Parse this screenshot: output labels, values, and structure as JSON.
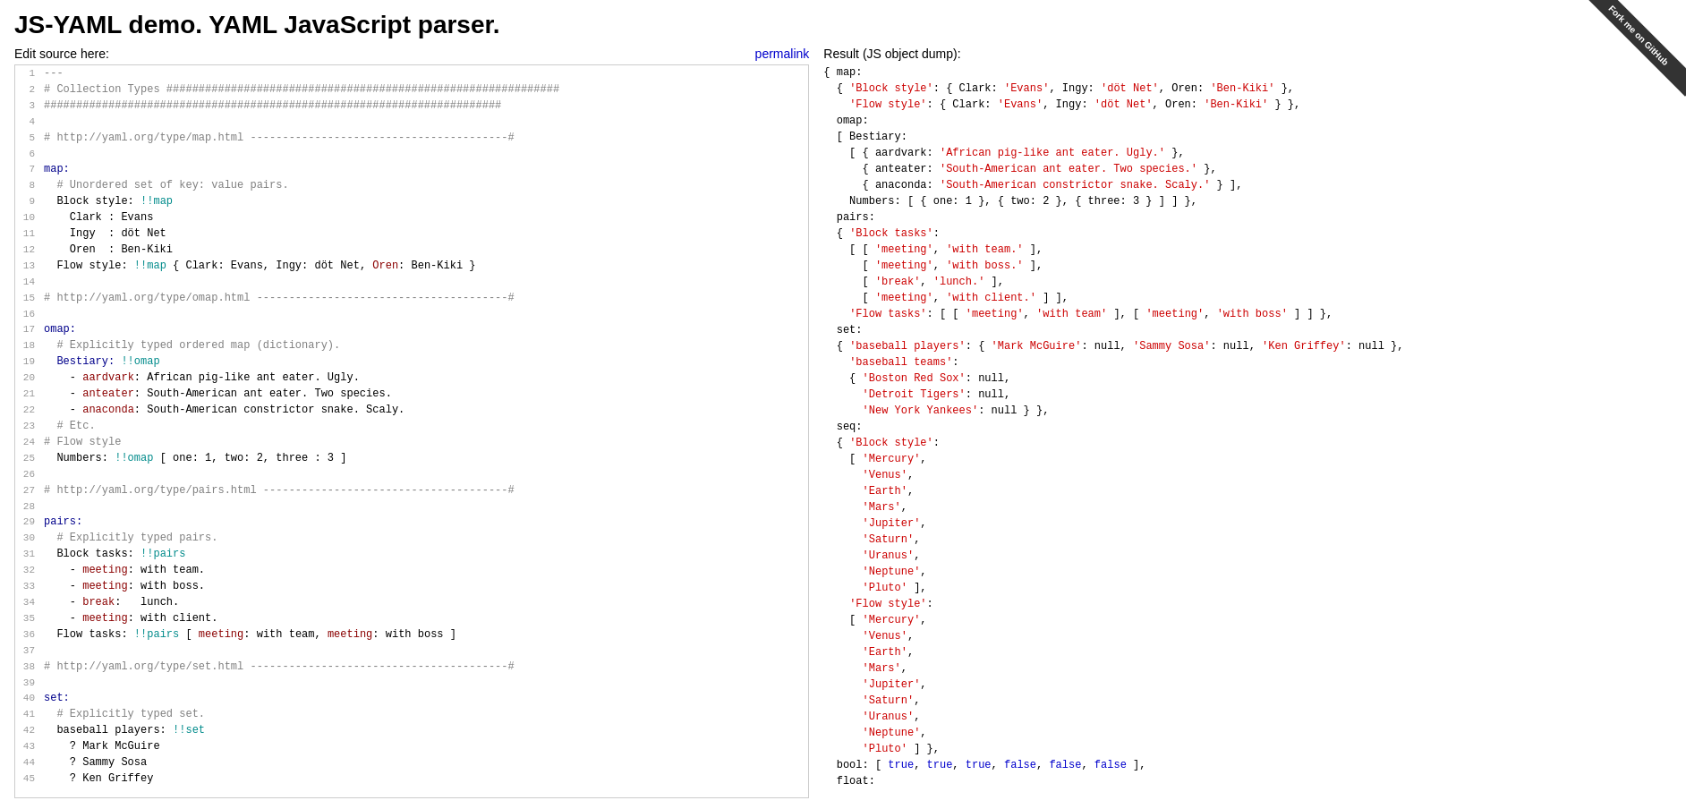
{
  "page": {
    "title": "JS-YAML demo. YAML JavaScript parser.",
    "left_header": "Edit source here:",
    "permalink_label": "permalink",
    "right_header": "Result (JS object dump):",
    "ribbon_text": "Fork me on GitHub"
  },
  "editor": {
    "lines": [
      "---",
      "# Collection Types #####################################################",
      "#######################################################################",
      "",
      "# http://yaml.org/type/map.html ----------------------------------------#",
      "",
      "map:",
      "  # Unordered set of key: value pairs.",
      "  Block style: !!map",
      "    Clark : Evans",
      "    Ingy  : döt Net",
      "    Oren  : Ben-Kiki",
      "  Flow style: !!map { Clark: Evans, Ingy: döt Net, Oren: Ben-Kiki }",
      "",
      "# http://yaml.org/type/omap.html ---------------------------------------#",
      "",
      "omap:",
      "  # Explicitly typed ordered map (dictionary).",
      "  Bestiary: !!omap",
      "    - aardvark: African pig-like ant eater. Ugly.",
      "    - anteater: South-American ant eater. Two species.",
      "    - anaconda: South-American constrictor snake. Scaly.",
      "  # Etc.",
      "# Flow style",
      "  Numbers: !!omap [ one: 1, two: 2, three : 3 ]",
      "",
      "# http://yaml.org/type/pairs.html --------------------------------------#",
      "",
      "pairs:",
      "  # Explicitly typed pairs.",
      "  Block tasks: !!pairs",
      "    - meeting: with team.",
      "    - meeting: with boss.",
      "    - break:   lunch.",
      "    - meeting: with client.",
      "  Flow tasks: !!pairs [ meeting: with team, meeting: with boss ]",
      "",
      "# http://yaml.org/type/set.html ----------------------------------------#",
      "",
      "set:",
      "  # Explicitly typed set.",
      "  baseball players: !!set",
      "    ? Mark McGuire",
      "    ? Sammy Sosa",
      "    ? Ken Griffey"
    ]
  }
}
